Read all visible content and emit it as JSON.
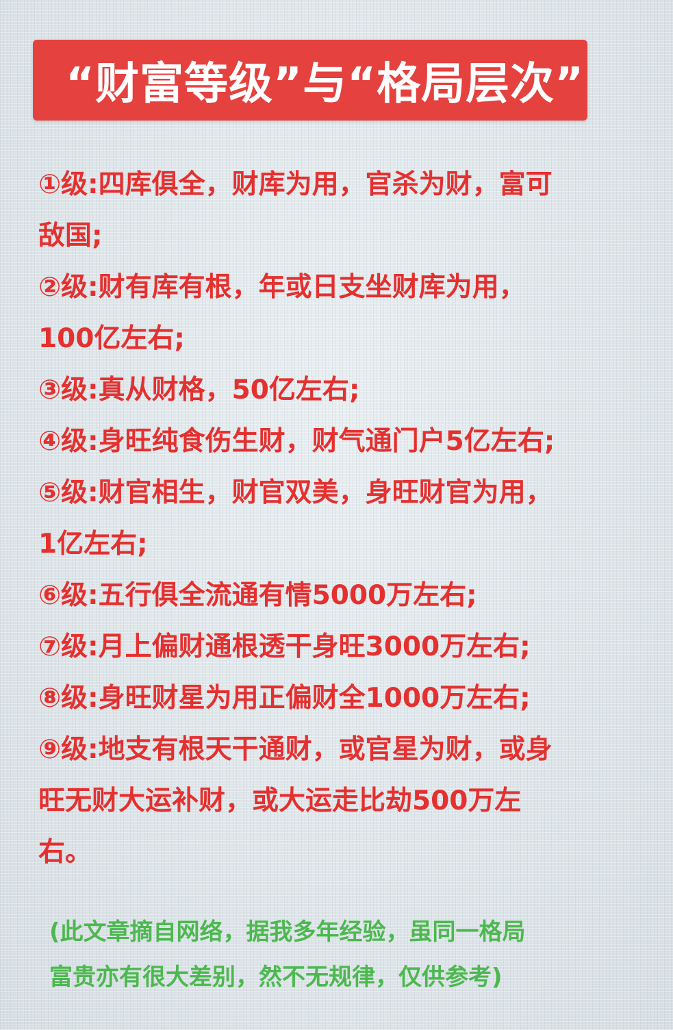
{
  "header": {
    "title": "“财富等级”与“格局层次”"
  },
  "levels": [
    "①级:四库俱全，财库为用，官杀为财，富可",
    "敌国;",
    "②级:财有库有根，年或日支坐财库为用，",
    "100亿左右;",
    "③级:真从财格，50亿左右;",
    "④级:身旺纯食伤生财，财气通门户5亿左右;",
    "⑤级:财官相生，财官双美，身旺财官为用，",
    "1亿左右;",
    "⑥级:五行俱全流通有情5000万左右;",
    "⑦级:月上偏财通根透干身旺3000万左右;",
    "⑧级:身旺财星为用正偏财全1000万左右;",
    "⑨级:地支有根天干通财，或官星为财，或身",
    "旺无财大运补财，或大运走比劫500万左",
    "右。"
  ],
  "footnote": [
    "(此文章摘自网络，据我多年经验，虽同一格局",
    "富贵亦有很大差别，然不无规律，仅供参考)"
  ],
  "colors": {
    "banner": "#e5413e",
    "level_text": "#e4302f",
    "footnote_text": "#4cb84f",
    "background": "#dfe6ea"
  }
}
